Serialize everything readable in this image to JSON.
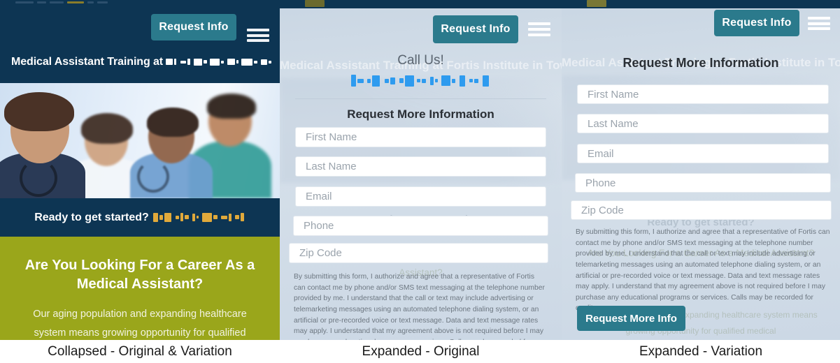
{
  "site": {
    "headline": "Medical Assistant Training at",
    "headline_full": "Medical Assistant Training at Fortis Institute in Towson",
    "request_info_label": "Request Info",
    "cta_prefix": "Ready to get started?",
    "green_heading": "Are You Looking For a Career As a Medical Assistant?",
    "green_body": "Our aging population and expanding healthcare system means growing opportunity for qualified medical"
  },
  "call_us": {
    "label": "Call Us!"
  },
  "form": {
    "title": "Request More Information",
    "fields": [
      {
        "placeholder": "First Name"
      },
      {
        "placeholder": "Last Name"
      },
      {
        "placeholder": "Email"
      },
      {
        "placeholder": "Phone"
      },
      {
        "placeholder": "Zip Code"
      }
    ],
    "disclaimer": "By submitting this form, I authorize and agree that a representative of Fortis can contact me by phone and/or SMS text messaging at the telephone number provided by me. I understand that the call or text may include advertising or telemarketing messages using an automated telephone dialing system, or an artificial or pre-recorded voice or text message. Data and text message rates may apply. I understand that my agreement above is not required before I may purchase any educational programs or services. Calls may be recorded for quality assurance purposes.",
    "submit_label": "Request More Info"
  },
  "captions": {
    "panel1": "Collapsed - Original & Variation",
    "panel2": "Expanded - Original",
    "panel3": "Expanded - Variation"
  },
  "colors": {
    "navy": "#0d3553",
    "teal": "#2b7a8c",
    "olive": "#9aa61b",
    "panel_bg": "#ced9e4",
    "redaction_gold": "#e0a93b",
    "redaction_blue": "#2e9bef",
    "redaction_white": "#ffffff"
  }
}
